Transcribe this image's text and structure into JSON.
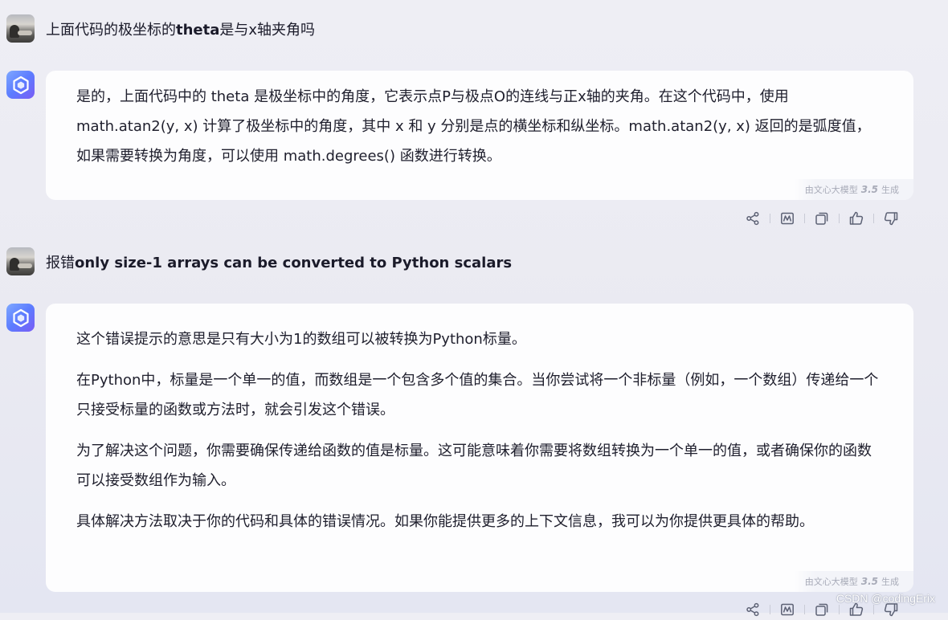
{
  "conversation": [
    {
      "role": "user",
      "text": "上面代码的极坐标的",
      "bold": "theta",
      "text_after": "是与x轴夹角吗"
    },
    {
      "role": "bot",
      "paragraphs": [
        "是的，上面代码中的 theta 是极坐标中的角度，它表示点P与极点O的连线与正x轴的夹角。在这个代码中，使用 math.atan2(y, x) 计算了极坐标中的角度，其中 x 和 y 分别是点的横坐标和纵坐标。math.atan2(y, x) 返回的是弧度值，如果需要转换为角度，可以使用 math.degrees() 函数进行转换。"
      ],
      "tag_prefix": "由文心大模型",
      "tag_version": "3.5",
      "tag_suffix": "生成"
    },
    {
      "role": "user",
      "text": "报错",
      "bold": "only size-1 arrays can be converted to Python scalars",
      "text_after": ""
    },
    {
      "role": "bot",
      "paragraphs": [
        "这个错误提示的意思是只有大小为1的数组可以被转换为Python标量。",
        "在Python中，标量是一个单一的值，而数组是一个包含多个值的集合。当你尝试将一个非标量（例如，一个数组）传递给一个只接受标量的函数或方法时，就会引发这个错误。",
        "为了解决这个问题，你需要确保传递给函数的值是标量。这可能意味着你需要将数组转换为一个单一的值，或者确保你的函数可以接受数组作为输入。",
        "具体解决方法取决于你的代码和具体的错误情况。如果你能提供更多的上下文信息，我可以为你提供更具体的帮助。"
      ],
      "tag_prefix": "由文心大模型",
      "tag_version": "3.5",
      "tag_suffix": "生成"
    }
  ],
  "actions": [
    "share-icon",
    "chart-icon",
    "copy-icon",
    "thumbs-up-icon",
    "thumbs-down-icon"
  ],
  "watermark": "CSDN @codingErix",
  "colors": {
    "accent_start": "#7fa8ff",
    "accent_end": "#7a5cf5",
    "background": "#ececf3",
    "bubble": "#fdfdfe"
  }
}
